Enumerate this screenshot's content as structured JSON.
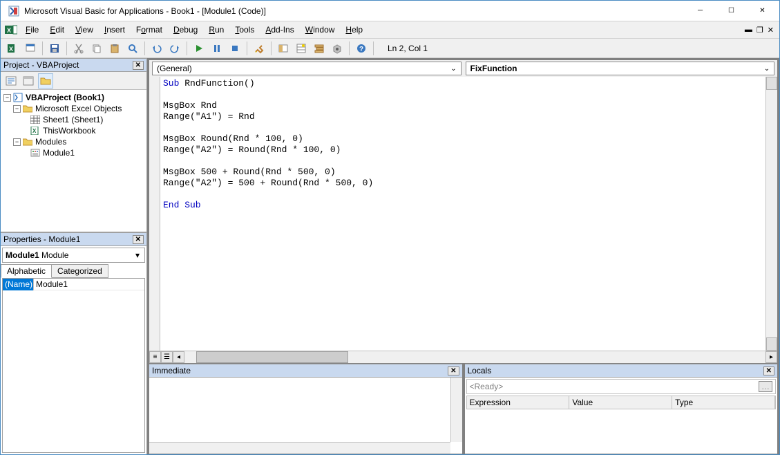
{
  "titlebar": {
    "title": "Microsoft Visual Basic for Applications - Book1 - [Module1 (Code)]"
  },
  "menu": {
    "file": "File",
    "edit": "Edit",
    "view": "View",
    "insert": "Insert",
    "format": "Format",
    "debug": "Debug",
    "run": "Run",
    "tools": "Tools",
    "addins": "Add-Ins",
    "window": "Window",
    "help": "Help"
  },
  "toolbar": {
    "cursor_pos": "Ln 2, Col 1"
  },
  "project_panel": {
    "title": "Project - VBAProject",
    "nodes": {
      "root": "VBAProject (Book1)",
      "group1": "Microsoft Excel Objects",
      "sheet1": "Sheet1 (Sheet1)",
      "thiswb": "ThisWorkbook",
      "group2": "Modules",
      "module1": "Module1"
    }
  },
  "properties_panel": {
    "title": "Properties - Module1",
    "object_name": "Module1",
    "object_type": "Module",
    "tabs": {
      "alpha": "Alphabetic",
      "cat": "Categorized"
    },
    "rows": [
      {
        "k": "(Name)",
        "v": "Module1"
      }
    ]
  },
  "code_pane": {
    "scope_dd": "(General)",
    "proc_dd": "FixFunction",
    "lines": [
      {
        "t": "kw",
        "text": "Sub ",
        "rest": "RndFunction()"
      },
      {
        "t": "",
        "text": ""
      },
      {
        "t": "",
        "text": "MsgBox Rnd"
      },
      {
        "t": "",
        "text": "Range(\"A1\") = Rnd"
      },
      {
        "t": "",
        "text": ""
      },
      {
        "t": "",
        "text": "MsgBox Round(Rnd * 100, 0)"
      },
      {
        "t": "",
        "text": "Range(\"A2\") = Round(Rnd * 100, 0)"
      },
      {
        "t": "",
        "text": ""
      },
      {
        "t": "",
        "text": "MsgBox 500 + Round(Rnd * 500, 0)"
      },
      {
        "t": "",
        "text": "Range(\"A2\") = 500 + Round(Rnd * 500, 0)"
      },
      {
        "t": "",
        "text": ""
      },
      {
        "t": "kw",
        "text": "End Sub",
        "rest": ""
      }
    ]
  },
  "immediate": {
    "title": "Immediate"
  },
  "locals": {
    "title": "Locals",
    "ready": "<Ready>",
    "cols": {
      "expr": "Expression",
      "val": "Value",
      "type": "Type"
    }
  }
}
